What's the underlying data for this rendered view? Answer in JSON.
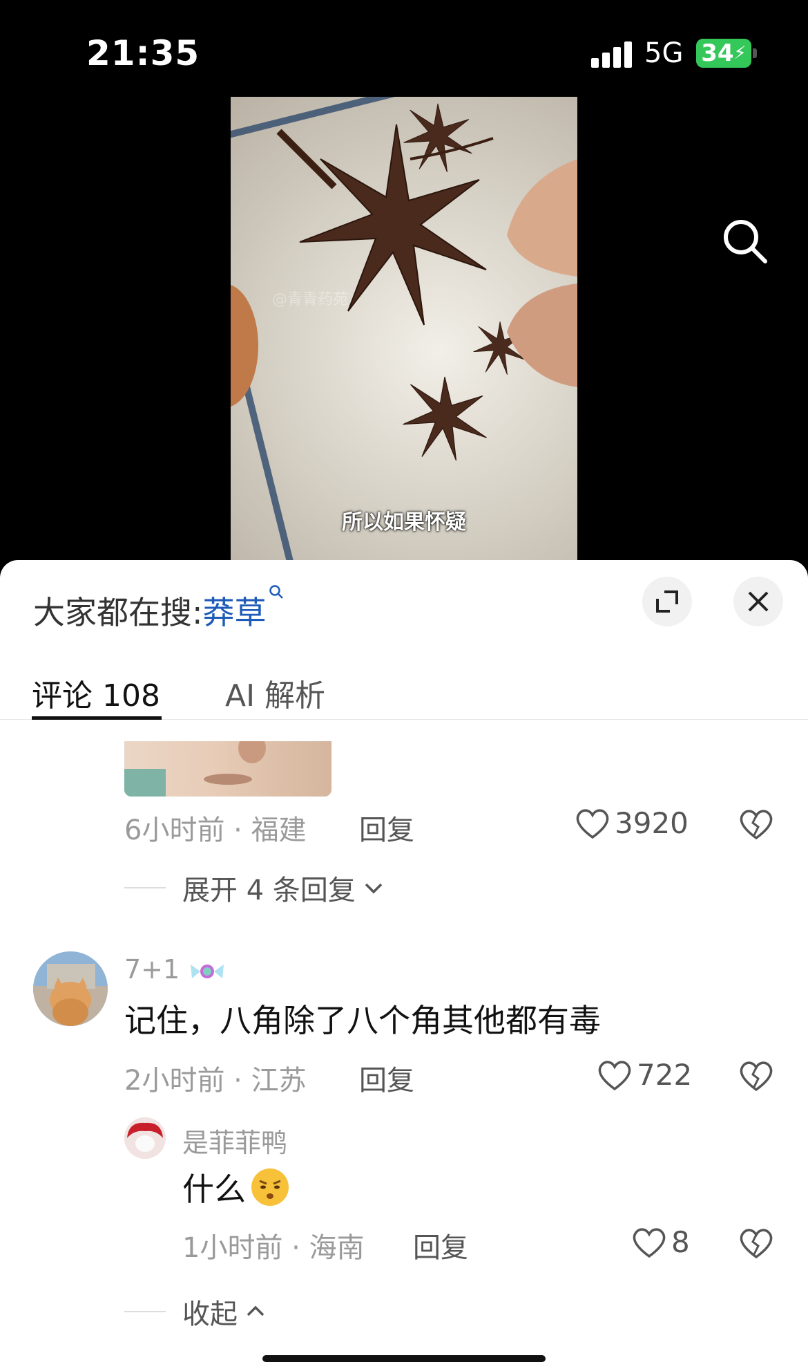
{
  "status_bar": {
    "time": "21:35",
    "network": "5G",
    "battery": "34"
  },
  "video": {
    "caption": "所以如果怀疑",
    "watermark": "@青青药苑"
  },
  "sheet": {
    "hot_search_prefix": "大家都在搜:",
    "hot_search_term": "莽草",
    "tabs": [
      {
        "label": "评论 108"
      },
      {
        "label": "AI 解析"
      }
    ]
  },
  "comments": [
    {
      "meta": "6小时前 · 福建",
      "reply": "回复",
      "likes": "3920",
      "expand": "展开 4 条回复"
    },
    {
      "username": "7+1",
      "text": "记住，八角除了八个角其他都有毒",
      "meta": "2小时前 · 江苏",
      "reply": "回复",
      "likes": "722",
      "replies": [
        {
          "username": "是菲菲鸭",
          "text": "什么",
          "meta": "1小时前 · 海南",
          "reply": "回复",
          "likes": "8"
        }
      ],
      "collapse": "收起"
    }
  ],
  "colors": {
    "hot_search_link": "#1e5bb8",
    "battery": "#34c759"
  },
  "icons": {
    "search": "search-icon",
    "expand": "expand-icon",
    "close": "close-icon",
    "like": "heart-icon",
    "dislike": "broken-heart-icon"
  }
}
